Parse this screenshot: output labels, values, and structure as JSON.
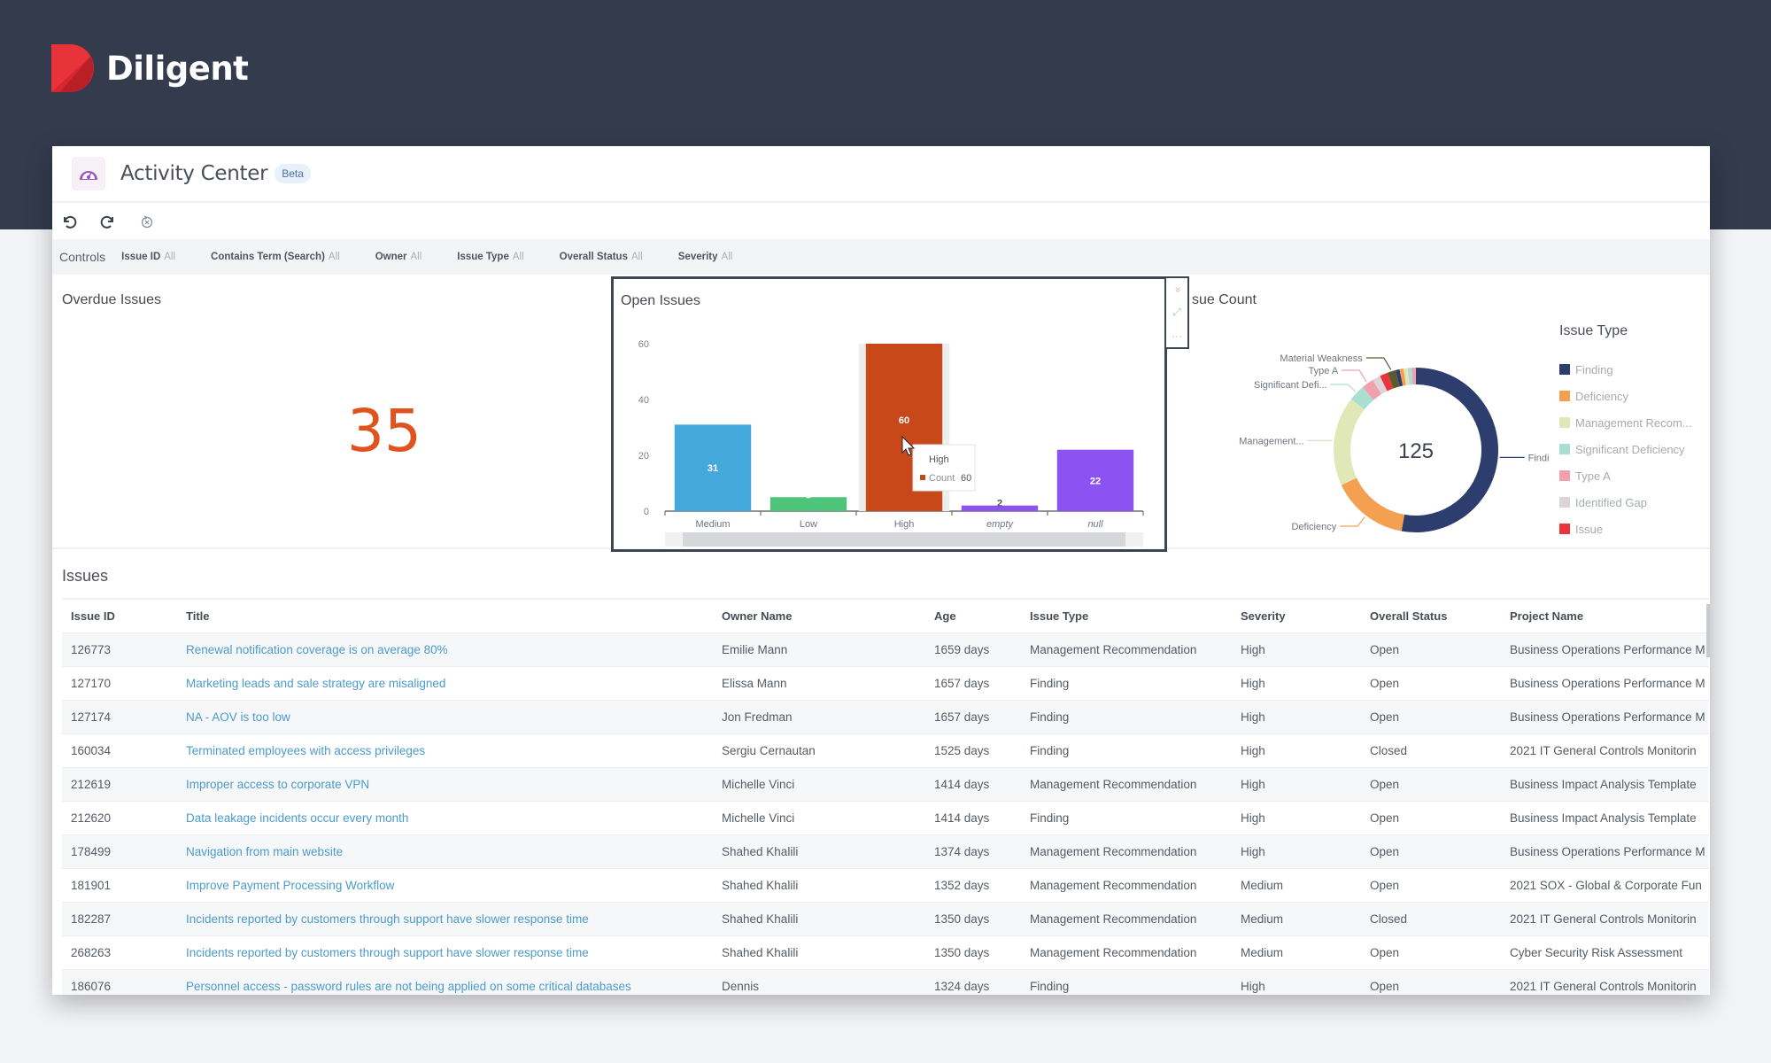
{
  "brand": {
    "name": "Diligent",
    "logo_icon": "diligent-d-logo"
  },
  "app": {
    "title": "Activity Center",
    "badge": "Beta",
    "icon": "dashboard-gauge-icon"
  },
  "toolbar": {
    "undo": "undo-icon",
    "redo": "redo-icon",
    "reset": "reset-icon"
  },
  "controls": {
    "title": "Controls",
    "filters": [
      {
        "label": "Issue ID",
        "value": "All"
      },
      {
        "label": "Contains Term (Search)",
        "value": "All"
      },
      {
        "label": "Owner",
        "value": "All"
      },
      {
        "label": "Issue Type",
        "value": "All"
      },
      {
        "label": "Overall Status",
        "value": "All"
      },
      {
        "label": "Severity",
        "value": "All"
      }
    ]
  },
  "overdue": {
    "title": "Overdue Issues",
    "value": "35",
    "color": "#e0531f"
  },
  "widget_tools": {
    "collapse": "«",
    "expand": "⤢",
    "more": "···"
  },
  "donut_title": "Issue Count",
  "donut_title_visible": "sue Count",
  "legend": {
    "title": "Issue Type",
    "items": [
      {
        "label": "Finding",
        "color": "#2d3e6e"
      },
      {
        "label": "Deficiency",
        "color": "#f5a050"
      },
      {
        "label": "Management Recom...",
        "color": "#dfe8b6"
      },
      {
        "label": "Significant Deficiency",
        "color": "#a8dfd0"
      },
      {
        "label": "Type A",
        "color": "#f0a0ae"
      },
      {
        "label": "Identified Gap",
        "color": "#dcd4d9"
      },
      {
        "label": "Issue",
        "color": "#e8343a"
      }
    ]
  },
  "chart_data": [
    {
      "type": "bar",
      "title": "Open Issues",
      "categories": [
        "Medium",
        "Low",
        "High",
        "empty",
        "null"
      ],
      "values": [
        31,
        5,
        60,
        2,
        22
      ],
      "colors": [
        "#44a8dc",
        "#4dc47a",
        "#c8481a",
        "#8d52f2",
        "#8d52f2"
      ],
      "ylim": [
        0,
        60
      ],
      "yticks": [
        0,
        20,
        40,
        60
      ],
      "xlabel": "",
      "ylabel": "",
      "tooltip": {
        "category": "High",
        "series": "Count",
        "value": 60
      },
      "highlighted": "High"
    },
    {
      "type": "pie",
      "title": "Issue Count",
      "center_label": "125",
      "total": 125,
      "slices": [
        {
          "label": "Finding",
          "value": 66,
          "color": "#2d3e6e"
        },
        {
          "label": "Deficiency",
          "value": 19,
          "color": "#f5a050"
        },
        {
          "label": "Management...",
          "value": 22,
          "color": "#dfe8b6"
        },
        {
          "label": "Significant Defi...",
          "value": 4,
          "color": "#a8dfd0"
        },
        {
          "label": "Type A",
          "value": 3,
          "color": "#f0a0ae"
        },
        {
          "label": "Identified Gap",
          "value": 2,
          "color": "#dcd4d9"
        },
        {
          "label": "Issue",
          "value": 2,
          "color": "#e8343a"
        },
        {
          "label": "Material Weakness",
          "value": 2,
          "color": "#5a5a2e"
        },
        {
          "label": "",
          "value": 1,
          "color": "#2d3e6e"
        },
        {
          "label": "",
          "value": 1,
          "color": "#f5a050"
        },
        {
          "label": "",
          "value": 1,
          "color": "#dfe8b6"
        },
        {
          "label": "",
          "value": 1,
          "color": "#a8dfd0"
        },
        {
          "label": "",
          "value": 1,
          "color": "#f0a0ae"
        }
      ],
      "callouts": [
        "Finding",
        "Deficiency",
        "Management...",
        "Significant Defi...",
        "Type A",
        "Material Weakness"
      ]
    }
  ],
  "issues": {
    "title": "Issues",
    "columns": [
      "Issue ID",
      "Title",
      "Owner Name",
      "Age",
      "Issue Type",
      "Severity",
      "Overall Status",
      "Project Name"
    ],
    "rows": [
      [
        "126773",
        "Renewal notification coverage is on average 80%",
        "Emilie Mann",
        "1659 days",
        "Management Recommendation",
        "High",
        "Open",
        "Business Operations Performance M"
      ],
      [
        "127170",
        "Marketing leads and sale strategy are misaligned",
        "Elissa Mann",
        "1657 days",
        "Finding",
        "High",
        "Open",
        "Business Operations Performance M"
      ],
      [
        "127174",
        "NA - AOV is too low",
        "Jon Fredman",
        "1657 days",
        "Finding",
        "High",
        "Open",
        "Business Operations Performance M"
      ],
      [
        "160034",
        "Terminated employees with access privileges",
        "Sergiu Cernautan",
        "1525 days",
        "Finding",
        "High",
        "Closed",
        "2021 IT General Controls Monitorin"
      ],
      [
        "212619",
        "Improper access to corporate VPN",
        "Michelle Vinci",
        "1414 days",
        "Management Recommendation",
        "High",
        "Open",
        "Business Impact Analysis Template"
      ],
      [
        "212620",
        "Data leakage incidents occur every month",
        "Michelle Vinci",
        "1414 days",
        "Finding",
        "High",
        "Open",
        "Business Impact Analysis Template"
      ],
      [
        "178499",
        "Navigation from main website",
        "Shahed Khalili",
        "1374 days",
        "Management Recommendation",
        "High",
        "Open",
        "Business Operations Performance M"
      ],
      [
        "181901",
        "Improve Payment Processing Workflow",
        "Shahed Khalili",
        "1352 days",
        "Management Recommendation",
        "Medium",
        "Open",
        "2021 SOX - Global & Corporate Fun"
      ],
      [
        "182287",
        "Incidents reported by customers through support have slower response time",
        "Shahed Khalili",
        "1350 days",
        "Management Recommendation",
        "Medium",
        "Closed",
        "2021 IT General Controls Monitorin"
      ],
      [
        "268263",
        "Incidents reported by customers through support have slower response time",
        "Shahed Khalili",
        "1350 days",
        "Management Recommendation",
        "Medium",
        "Open",
        "Cyber Security Risk Assessment"
      ],
      [
        "186076",
        "Personnel access - password rules are not being applied on some critical databases",
        "Dennis",
        "1324 days",
        "Finding",
        "High",
        "Open",
        "2021 IT General Controls Monitorin"
      ]
    ]
  }
}
